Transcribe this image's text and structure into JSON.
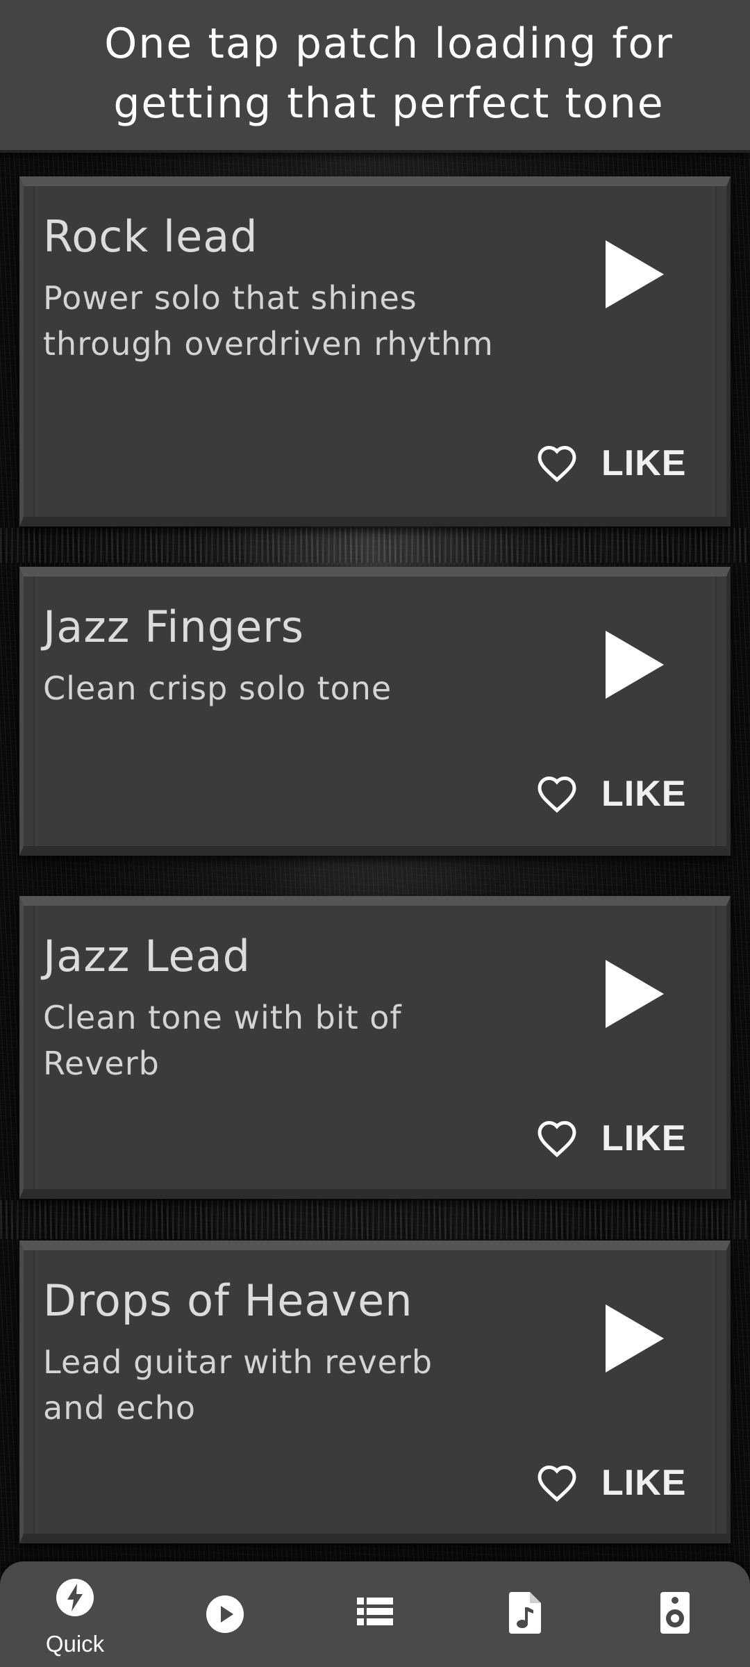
{
  "header": {
    "title_line1": "One tap patch loading for",
    "title_line2": "getting that perfect tone"
  },
  "cards": [
    {
      "title": "Rock lead",
      "description": "Power solo that shines through overdriven rhythm",
      "like_label": "LIKE"
    },
    {
      "title": "Jazz Fingers",
      "description": "Clean crisp solo tone",
      "like_label": "LIKE"
    },
    {
      "title": "Jazz Lead",
      "description": "Clean tone with bit of Reverb",
      "like_label": "LIKE"
    },
    {
      "title": "Drops of Heaven",
      "description": "Lead guitar with reverb and echo",
      "like_label": "LIKE"
    }
  ],
  "bottom_nav": {
    "items": [
      {
        "label": "Quick",
        "icon": "bolt-icon",
        "active": true
      },
      {
        "label": "",
        "icon": "play-circle-icon",
        "active": false
      },
      {
        "label": "",
        "icon": "list-icon",
        "active": false
      },
      {
        "label": "",
        "icon": "music-file-icon",
        "active": false
      },
      {
        "label": "",
        "icon": "speaker-icon",
        "active": false
      }
    ]
  },
  "colors": {
    "header_bg": "#444444",
    "card_bg": "#3b3b3b",
    "nav_bg": "#4a4a4a",
    "text": "#dcdcdc"
  }
}
